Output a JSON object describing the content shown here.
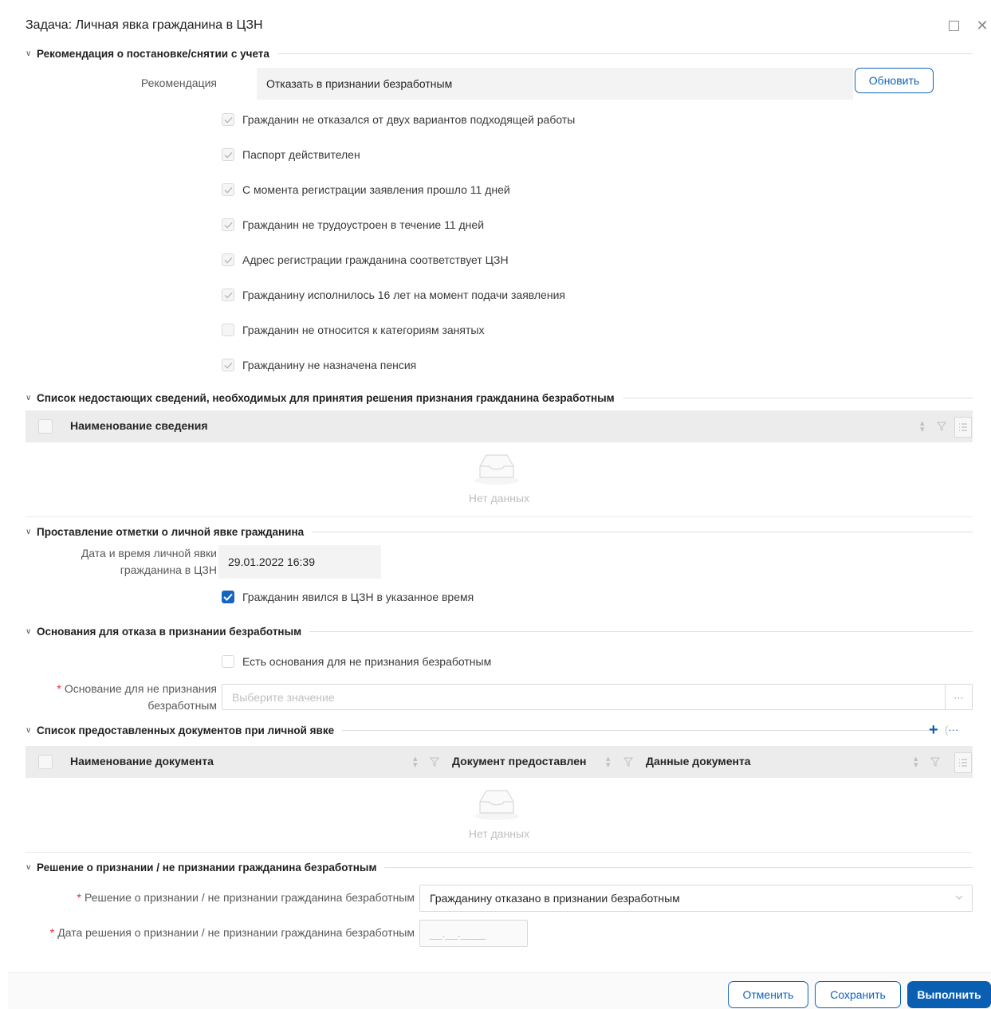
{
  "window": {
    "title": "Задача: Личная явка гражданина в ЦЗН"
  },
  "recommendation_section": {
    "title": "Рекомендация о постановке/снятии с учета",
    "field_label": "Рекомендация",
    "field_value": "Отказать в признании безработным",
    "refresh_label": "Обновить",
    "checks": [
      {
        "label": "Гражданин не отказался от двух вариантов подходящей работы",
        "checked": true
      },
      {
        "label": "Паспорт действителен",
        "checked": true
      },
      {
        "label": "С момента регистрации заявления прошло 11 дней",
        "checked": true
      },
      {
        "label": "Гражданин не трудоустроен в течение 11 дней",
        "checked": true
      },
      {
        "label": "Адрес регистрации гражданина соответствует ЦЗН",
        "checked": true
      },
      {
        "label": "Гражданину исполнилось 16 лет на момент подачи заявления",
        "checked": true
      },
      {
        "label": "Гражданин не относится к категориям занятых",
        "checked": false
      },
      {
        "label": "Гражданину не назначена пенсия",
        "checked": true
      }
    ]
  },
  "missing_section": {
    "title": "Список недостающих сведений, необходимых для принятия решения признания гражданина безработным",
    "column": "Наименование сведения",
    "empty_text": "Нет данных"
  },
  "attendance_section": {
    "title": "Проставление отметки о личной явке гражданина",
    "date_label_line1": "Дата и время личной явки",
    "date_label_line2": "гражданина в ЦЗН",
    "date_value": "29.01.2022 16:39",
    "attended_label": "Гражданин явился в ЦЗН в указанное время",
    "attended_checked": true
  },
  "refusal_section": {
    "title": "Основания для отказа в признании безработным",
    "has_grounds_label": "Есть основания для не признания безработным",
    "has_grounds_checked": false,
    "reason_label_line1": "Основание для не признания",
    "reason_label_line2": "безработным",
    "reason_placeholder": "Выберите значение",
    "ellipsis": "···"
  },
  "documents_section": {
    "title": "Список предоставленных документов при личной явке",
    "add_symbol": "+",
    "more_symbol": "···",
    "columns": [
      "Наименование документа",
      "Документ предоставлен",
      "Данные документа"
    ],
    "empty_text": "Нет данных"
  },
  "decision_section": {
    "title": "Решение о признании / не признании гражданина безработным",
    "decision_label": "Решение о признании / не признании гражданина безработным",
    "decision_value": "Гражданину отказано в признании безработным",
    "date_label": "Дата решения о признании / не признании гражданина безработным",
    "date_placeholder": "__.__.____"
  },
  "footer": {
    "cancel_label": "Отменить",
    "save_label": "Сохранить",
    "execute_label": "Выполнить"
  },
  "colors": {
    "accent": "#0b5fb3",
    "required": "#f5222d"
  },
  "icons": [
    "maximize-icon",
    "close-icon",
    "chevron-down-icon",
    "checkmark-icon",
    "sort-icon",
    "filter-icon",
    "column-settings-icon",
    "empty-inbox-icon",
    "plus-icon",
    "ellipsis-icon"
  ]
}
